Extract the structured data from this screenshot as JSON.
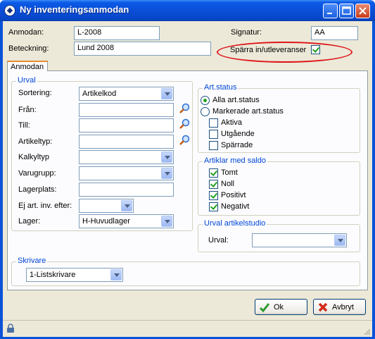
{
  "window": {
    "title": "Ny inventeringsanmodan"
  },
  "header": {
    "anmodan_label": "Anmodan:",
    "anmodan_value": "L-2008",
    "signatur_label": "Signatur:",
    "signatur_value": "AA",
    "beteckning_label": "Beteckning:",
    "beteckning_value": "Lund 2008",
    "sparra_label": "Spärra in/utleveranser",
    "sparra_checked": true
  },
  "tabs": [
    {
      "label": "Anmodan"
    }
  ],
  "urval": {
    "title": "Urval",
    "sortering_label": "Sortering:",
    "sortering_value": "Artikelkod",
    "fran_label": "Från:",
    "fran_value": "",
    "till_label": "Till:",
    "till_value": "",
    "artikeltyp_label": "Artikeltyp:",
    "artikeltyp_value": "",
    "kalkyltyp_label": "Kalkyltyp",
    "kalkyltyp_value": "",
    "varugrupp_label": "Varugrupp:",
    "varugrupp_value": "",
    "lagerplats_label": "Lagerplats:",
    "lagerplats_value": "",
    "ej_label": "Ej art. inv. efter:",
    "ej_value": "",
    "lager_label": "Lager:",
    "lager_value": "H-Huvudlager"
  },
  "art_status": {
    "title": "Art.status",
    "alla_label": "Alla art.status",
    "alla_selected": true,
    "markerade_label": "Markerade art.status",
    "markerade_selected": false,
    "aktiva_label": "Aktiva",
    "aktiva_checked": false,
    "utgaende_label": "Utgående",
    "utgaende_checked": false,
    "sparrade_label": "Spärrade",
    "sparrade_checked": false
  },
  "saldo": {
    "title": "Artiklar med saldo",
    "tomt_label": "Tomt",
    "tomt_checked": true,
    "noll_label": "Noll",
    "noll_checked": true,
    "positivt_label": "Positivt",
    "positivt_checked": true,
    "negativt_label": "Negativt",
    "negativt_checked": true
  },
  "urval_studio": {
    "title": "Urval artikelstudio",
    "urval_label": "Urval:",
    "urval_value": ""
  },
  "skrivare": {
    "title": "Skrivare",
    "value": "1-Listskrivare"
  },
  "buttons": {
    "ok_label": "Ok",
    "avbryt_label": "Avbryt"
  },
  "colors": {
    "accent": "#0046d5",
    "highlight_oval": "#e0151a",
    "titlebar": "#0a4fd8"
  },
  "icons": [
    "app-icon",
    "minimize-icon",
    "maximize-icon",
    "close-icon",
    "search-icon",
    "check-icon",
    "cancel-icon",
    "lock-icon",
    "resize-grip-icon"
  ]
}
